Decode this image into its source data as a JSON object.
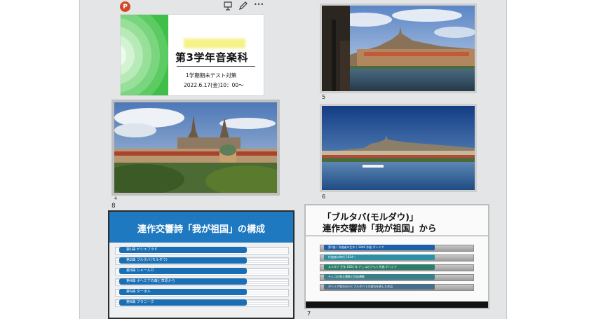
{
  "toolbar": {
    "app_icon_letter": "P",
    "icons": [
      "presenter-icon",
      "pencil-icon",
      "more-icon"
    ],
    "more_glyph": "•••"
  },
  "slides": {
    "s1": {
      "title": "第3学年音楽科",
      "subtitle": "1学期期末テスト対策",
      "date": "2022.6.17(金)10：00～"
    },
    "s4": {
      "number": "4",
      "image": "castle-closeup-photo"
    },
    "s5": {
      "number": "5",
      "image": "bridge-view-photo"
    },
    "s6": {
      "number": "6",
      "image": "river-panorama-photo"
    },
    "s8": {
      "number": "8",
      "title": "連作交響詩「我が祖国」の構成",
      "items": [
        "第1曲 ビシェフラド",
        "第2曲 ブルタバ(モルダウ)",
        "第3曲 シャールカ",
        "第4曲 ボヘミアの森と草原から",
        "第5曲 ターボル",
        "第6曲 ブラニーク"
      ]
    },
    "s7": {
      "number": "7",
      "title_line1": "「ブルタバ(モルダウ)」",
      "title_line2": "連作交響詩「我が祖国」から",
      "items": [
        "第1曲 ( 作曲者の生年 ) 1848 作曲 ボヘミア",
        "作曲者の時代 1824～",
        "スメタナ 生年 1824 年 チェコのプラハ 作曲 ボヘミア",
        "チェコの独立運動と民族運動",
        "ボヘミア地方の川 ( ブルタバ ) の流れを表した作品"
      ]
    }
  },
  "colors": {
    "s8_band": "#1f79c0",
    "s7_pills": [
      "#1f5fa8",
      "#2e8fa5",
      "#2e7d6a",
      "#3b7f8a",
      "#4a6e8a"
    ]
  }
}
